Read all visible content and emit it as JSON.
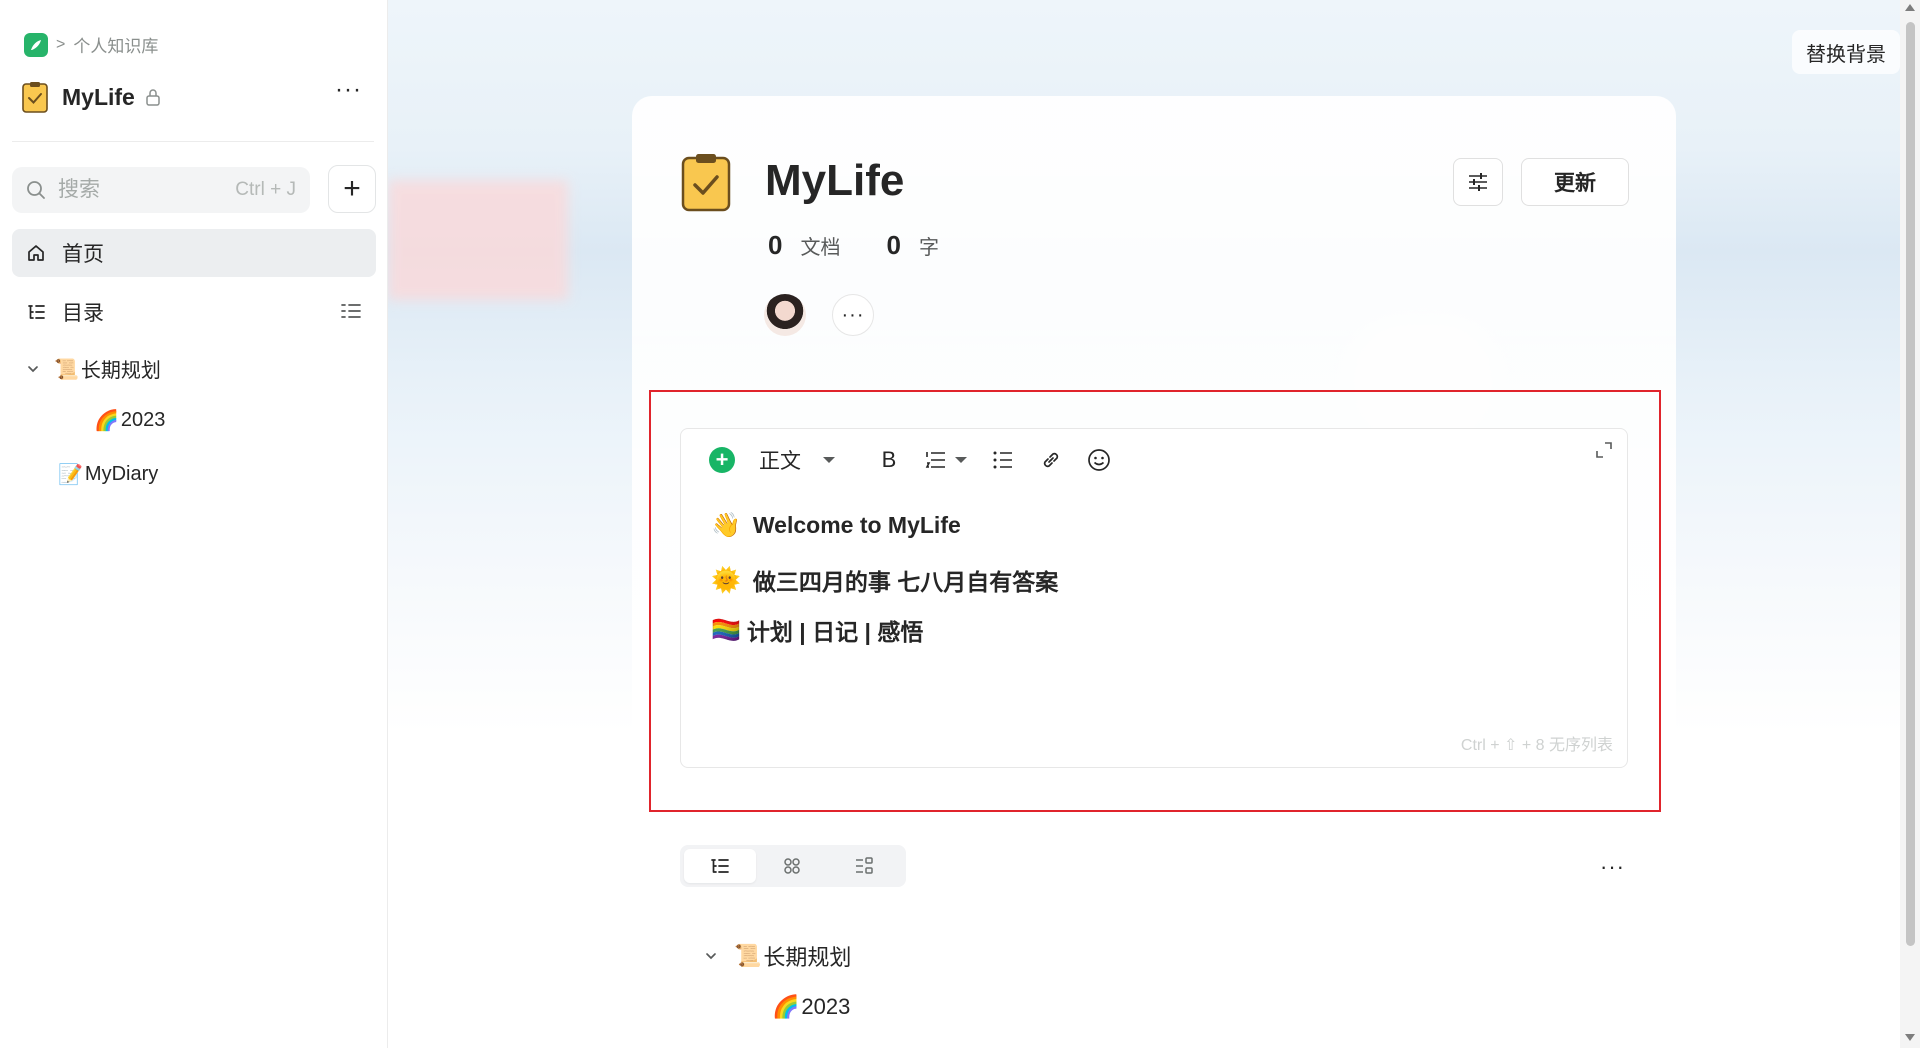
{
  "sidebar": {
    "breadcrumb": {
      "separator": ">",
      "label": "个人知识库"
    },
    "kb_title": "MyLife",
    "more": "···",
    "search": {
      "placeholder": "搜索",
      "shortcut": "Ctrl + J"
    },
    "add": "+",
    "nav": [
      {
        "label": "首页",
        "icon": "home-icon",
        "active": true
      },
      {
        "label": "目录",
        "icon": "toc-icon",
        "active": false
      }
    ],
    "tree": [
      {
        "emoji": "📜",
        "label": "长期规划",
        "expanded": true
      },
      {
        "emoji": "🌈",
        "label": "2023"
      },
      {
        "emoji": "📝",
        "label": "MyDiary"
      }
    ]
  },
  "main": {
    "replace_bg": "替换背景",
    "title": "MyLife",
    "stats": {
      "docs_count": "0",
      "docs_unit": "文档",
      "words_count": "0",
      "words_unit": "字"
    },
    "avatar_more": "···",
    "update_button": "更新",
    "editor": {
      "style": "正文",
      "bold": "B",
      "lines": [
        {
          "emoji": "👋",
          "text": "Welcome to MyLife"
        },
        {
          "emoji": "🌞",
          "text": "做三四月的事 七八月自有答案"
        },
        {
          "emoji": "🏳️‍🌈",
          "text": "计划 | 日记 | 感悟"
        }
      ],
      "hint": "Ctrl + ⇧ + 8  无序列表"
    },
    "list_more": "···",
    "tree": [
      {
        "emoji": "📜",
        "label": "长期规划"
      },
      {
        "emoji": "🌈",
        "label": "2023"
      }
    ]
  },
  "colors": {
    "accent_green": "#18b566",
    "highlight_red": "#e0242c",
    "active_nav": "#eceef0"
  }
}
